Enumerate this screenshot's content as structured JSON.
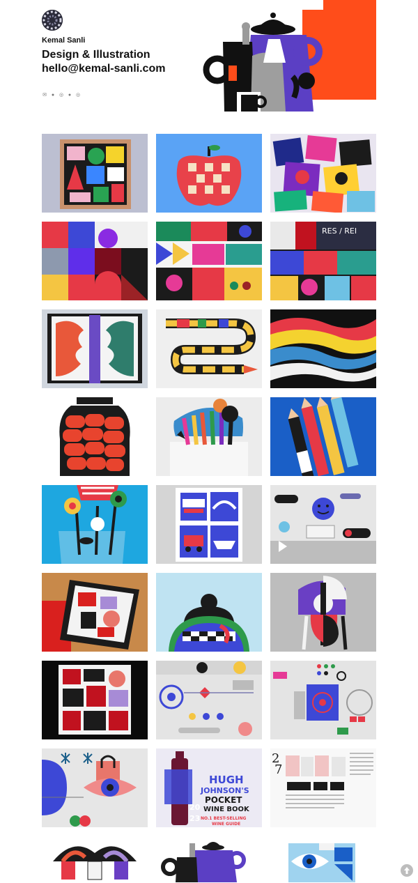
{
  "profile": {
    "name": "Kemal Sanli",
    "tagline": "Design & Illustration hello@kemal-sanli.com"
  },
  "social_icons": [
    "email-icon",
    "twitter-icon",
    "instagram-icon",
    "behance-icon",
    "dribbble-icon"
  ],
  "accent_color": "#FF4D1A",
  "portfolio": {
    "rows": 9,
    "columns": 3,
    "tile_count": 27
  },
  "back_to_top_icon": "arrow-up-icon"
}
